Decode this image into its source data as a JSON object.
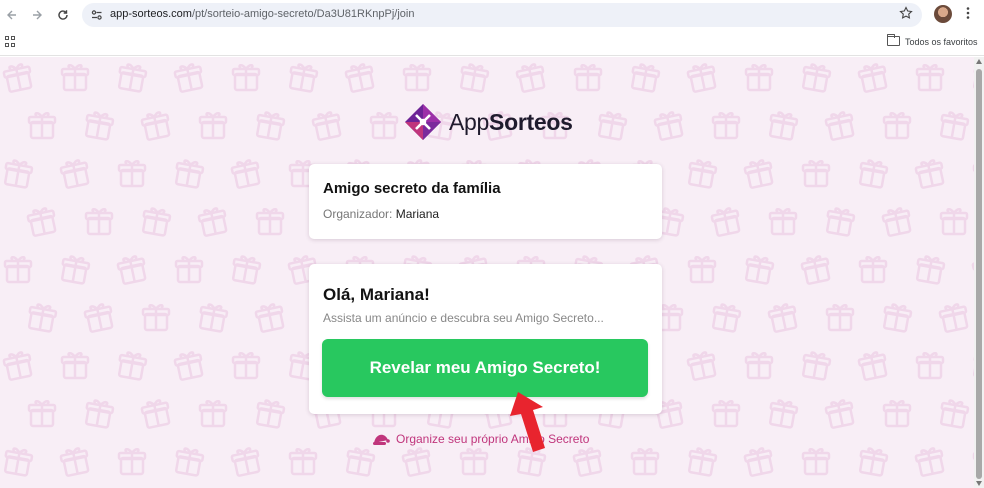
{
  "browser": {
    "url_host": "app-sorteos.com",
    "url_path": "/pt/sorteio-amigo-secreto/Da3U81RKnpPj/join",
    "bookmarks_folder_label": "Todos os favoritos"
  },
  "brand": {
    "name_part1": "App",
    "name_part2": "Sorteos",
    "accent_color": "#c0357c",
    "logo_color": "#8e2ea3"
  },
  "event_card": {
    "title": "Amigo secreto da família",
    "organizer_label": "Organizador:",
    "organizer_name": "Mariana"
  },
  "reveal_card": {
    "greeting": "Olá, Mariana!",
    "hint": "Assista um anúncio e descubra seu Amigo Secreto...",
    "button_label": "Revelar meu Amigo Secreto!",
    "button_color": "#28c85f"
  },
  "footer_link": {
    "label": "Organize seu próprio Amigo Secreto"
  },
  "annotation": {
    "arrow_color": "#e8242e"
  }
}
